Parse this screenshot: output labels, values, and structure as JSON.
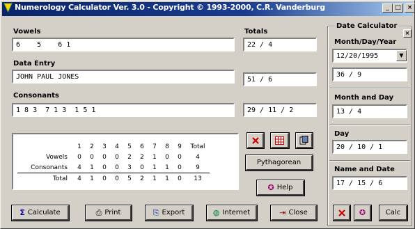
{
  "window": {
    "title": "Numerology Calculator Ver. 3.0 - Copyright © 1993-2000, C.R. Vanderburg",
    "minimize_label": "_",
    "maximize_label": "□",
    "close_label": "×"
  },
  "colors": {
    "title_bar": "#0a246a",
    "face": "#d4d0c8",
    "icon_red": "#cc0000"
  },
  "main": {
    "vowels_label": "Vowels",
    "vowels_value": "6    5    6 1",
    "totals_label": "Totals",
    "vowels_total": "22 / 4",
    "data_entry_label": "Data Entry",
    "data_entry_value": "JOHN PAUL JONES",
    "data_entry_total": "51 / 6",
    "consonants_label": "Consonants",
    "consonants_value": "1 8 3  7 1 3  1 5 1",
    "consonants_total": "29 / 11 / 2"
  },
  "table": {
    "headers": [
      "1",
      "2",
      "3",
      "4",
      "5",
      "6",
      "7",
      "8",
      "9",
      "Total"
    ],
    "rows": [
      {
        "label": "Vowels",
        "values": [
          "0",
          "0",
          "0",
          "0",
          "2",
          "2",
          "1",
          "0",
          "0",
          "4"
        ]
      },
      {
        "label": "Consonants",
        "values": [
          "4",
          "1",
          "0",
          "0",
          "3",
          "0",
          "1",
          "1",
          "0",
          "9"
        ]
      },
      {
        "label": "Total",
        "values": [
          "4",
          "1",
          "0",
          "0",
          "5",
          "2",
          "1",
          "1",
          "0",
          "13"
        ]
      }
    ]
  },
  "buttons": {
    "pythagorean": "Pythagorean",
    "help": "Help",
    "calculate": "Calculate",
    "print": "Print",
    "export": "Export",
    "internet": "Internet",
    "close": "Close",
    "calc": "Calc"
  },
  "date_calc": {
    "title": "Date Calculator",
    "birthday_label": "Month/Day/Year",
    "birthday_value": "12/20/1995",
    "birthday_result": "36 / 9",
    "month_day_label": "Month and Day",
    "month_day_value": "13 / 4",
    "day_label": "Day",
    "day_value": "20 / 10 / 1",
    "name_date_label": "Name and Date",
    "name_date_value": "17 / 15 / 6"
  }
}
